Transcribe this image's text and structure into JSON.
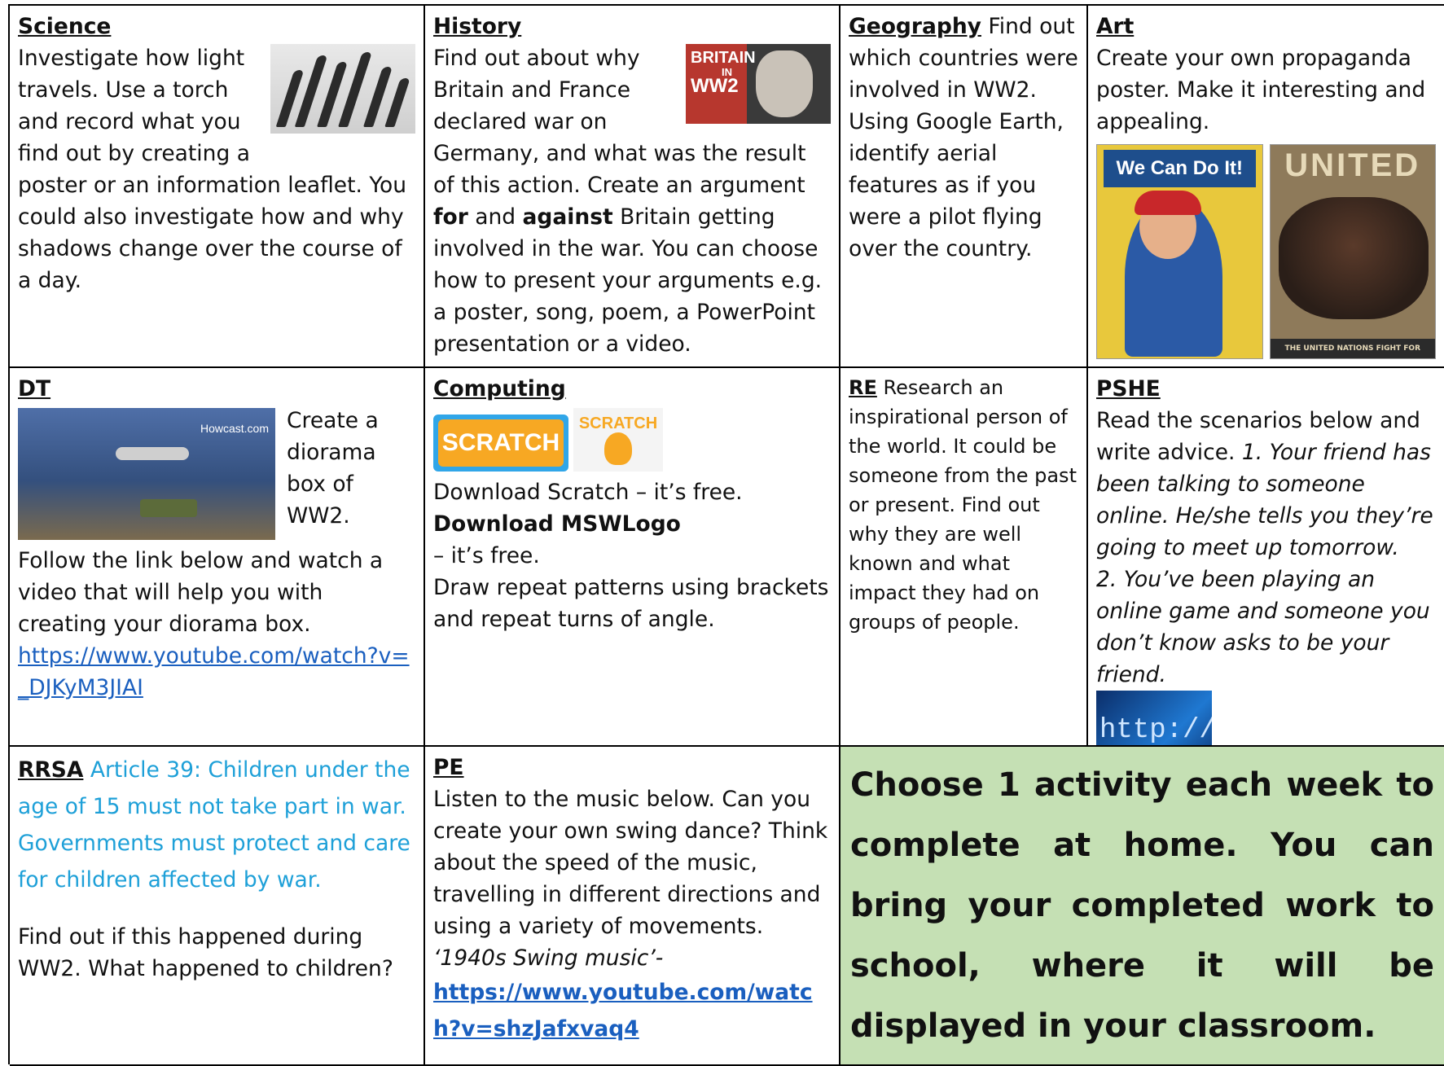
{
  "science": {
    "title": "Science",
    "text1": "Investigate how light travels.  Use a torch and record what you find out by creating a poster or an information leaflet. You could also investigate how and why shadows change over the course of a day."
  },
  "history": {
    "title": "History",
    "image_text_1": "BRITAIN",
    "image_text_2": "IN",
    "image_text_3": "WW2",
    "text1": "Find out about why Britain and France declared war on Germany, and what was the result of this action. Create an argument ",
    "for": "for",
    "and": " and ",
    "against": "against",
    "text2": " Britain getting involved in the war.  You can choose how to present your arguments e.g. a poster, song, poem, a PowerPoint presentation or a video."
  },
  "geography": {
    "title": "Geography",
    "text": " Find out which countries were involved in WW2. Using Google Earth, identify aerial features as if you were a pilot flying over the country."
  },
  "art": {
    "title": "Art",
    "text": "Create your own propaganda poster. Make it interesting and appealing.",
    "poster1_text": "We Can Do It!",
    "poster2_text": "UNITED",
    "poster2_footer": "THE UNITED NATIONS FIGHT FOR FREEDOM"
  },
  "dt": {
    "title": "DT",
    "image_label": "Howcast.com",
    "text1": "Create a diorama box of WW2.",
    "text2": "Follow the link below and watch a video that will help you with creating your diorama box.",
    "link": "https://www.youtube.com/watch?v=_DJKyM3JIAI"
  },
  "computing": {
    "title": "Computing",
    "logo1": "SCRATCH",
    "logo2": "SCRATCH",
    "text1": "Download Scratch – it’s free.",
    "text2": "Download MSWLogo",
    "text3": "– it’s free.",
    "text4": "Draw repeat patterns using brackets and repeat turns of angle."
  },
  "re": {
    "title": "RE",
    "text": " Research an inspirational person of the world. It could be someone from the past or present. Find out why they are well known and what impact they had on groups of people."
  },
  "pshe": {
    "title": "PSHE",
    "text": "Read the scenarios below and write advice. ",
    "scenario1": "1. Your friend has been talking to someone online. He/she tells you they’re going to meet up tomorrow.",
    "scenario2": "2. You’ve been playing an online game and someone you don’t know asks to be your friend.",
    "image_text": "http://www"
  },
  "rrsa": {
    "title": "RRSA",
    "article": " Article 39: Children under the age of 15 must not take part in war. Governments must protect and care for children affected by war.",
    "text": "Find out if this happened during WW2. What happened to children?"
  },
  "pe": {
    "title": "PE",
    "text": "Listen to the music below. Can you create your own swing dance? Think about the speed of the music, travelling in different directions and using a variety of movements.",
    "music": "‘1940s Swing music’-",
    "link": "https://www.youtube.com/watch?v=shzJafxvaq4"
  },
  "info": {
    "text": "Choose 1 activity each week to complete at home. You can bring your completed work to school, where it will be displayed in your classroom."
  }
}
